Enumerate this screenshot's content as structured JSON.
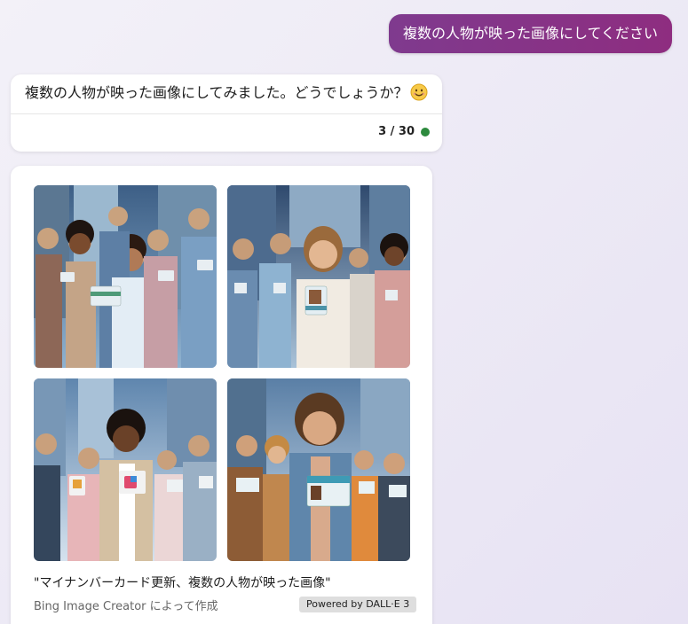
{
  "user_message": "複数の人物が映った画像にしてください",
  "bot_reply": {
    "text": "複数の人物が映った画像にしてみました。どうでしょうか？",
    "emoji": "smiling-face-emoji",
    "counter": "3 / 30",
    "status_color": "#2d8a3e"
  },
  "image_result": {
    "images": [
      {
        "name": "generated-image-1"
      },
      {
        "name": "generated-image-2"
      },
      {
        "name": "generated-image-3"
      },
      {
        "name": "generated-image-4"
      }
    ],
    "caption": "\"マイナンバーカード更新、複数の人物が映った画像\"",
    "creator": "Bing Image Creator によって作成",
    "powered_by": "Powered by DALL·E 3"
  },
  "colors": {
    "user_bubble": "#8e2d80",
    "background": "#ece9f5"
  }
}
